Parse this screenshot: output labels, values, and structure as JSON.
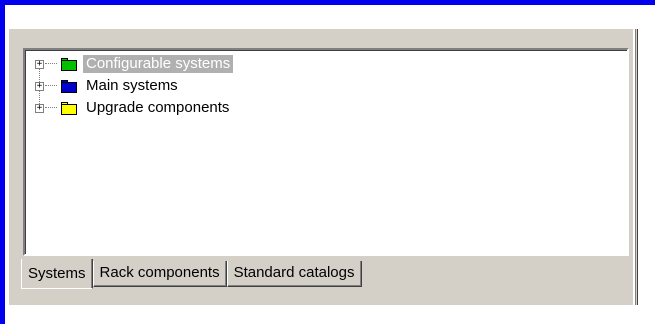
{
  "tree": {
    "nodes": [
      {
        "label": "Configurable systems",
        "expander": "+",
        "icon": "green-folder-icon",
        "color": "#00c000",
        "selected": true
      },
      {
        "label": "Main systems",
        "expander": "+",
        "icon": "blue-folder-icon",
        "color": "#0000cc",
        "selected": false
      },
      {
        "label": "Upgrade components",
        "expander": "+",
        "icon": "yellow-folder-icon",
        "color": "#ffff00",
        "selected": false
      }
    ]
  },
  "tabs": [
    {
      "label": "Systems",
      "active": true
    },
    {
      "label": "Rack components",
      "active": false
    },
    {
      "label": "Standard catalogs",
      "active": false
    }
  ]
}
